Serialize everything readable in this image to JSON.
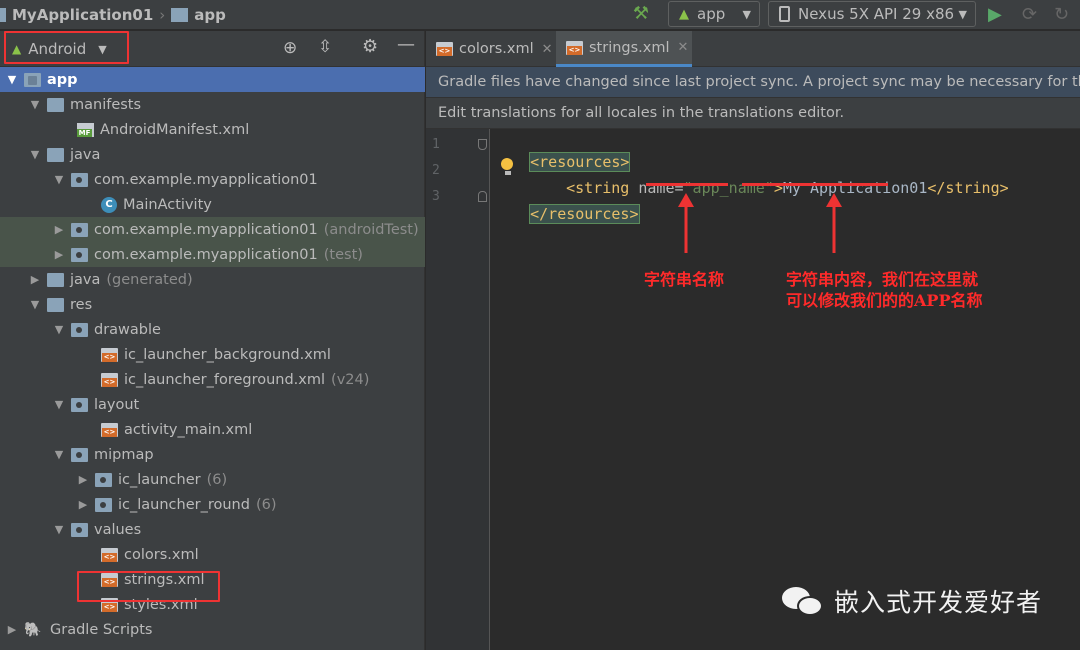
{
  "toolbar": {
    "project": "MyApplication01",
    "module": "app",
    "run_config": "app",
    "device": "Nexus 5X API 29 x86"
  },
  "project_view": {
    "view_mode": "Android",
    "tree": [
      {
        "label": "app",
        "suffix": ""
      },
      {
        "label": "manifests",
        "suffix": ""
      },
      {
        "label": "AndroidManifest.xml",
        "suffix": ""
      },
      {
        "label": "java",
        "suffix": ""
      },
      {
        "label": "com.example.myapplication01",
        "suffix": ""
      },
      {
        "label": "MainActivity",
        "suffix": ""
      },
      {
        "label": "com.example.myapplication01",
        "suffix": "(androidTest)"
      },
      {
        "label": "com.example.myapplication01",
        "suffix": "(test)"
      },
      {
        "label": "java",
        "suffix": "(generated)"
      },
      {
        "label": "res",
        "suffix": ""
      },
      {
        "label": "drawable",
        "suffix": ""
      },
      {
        "label": "ic_launcher_background.xml",
        "suffix": ""
      },
      {
        "label": "ic_launcher_foreground.xml",
        "suffix": "(v24)"
      },
      {
        "label": "layout",
        "suffix": ""
      },
      {
        "label": "activity_main.xml",
        "suffix": ""
      },
      {
        "label": "mipmap",
        "suffix": ""
      },
      {
        "label": "ic_launcher",
        "suffix": "(6)"
      },
      {
        "label": "ic_launcher_round",
        "suffix": "(6)"
      },
      {
        "label": "values",
        "suffix": ""
      },
      {
        "label": "colors.xml",
        "suffix": ""
      },
      {
        "label": "strings.xml",
        "suffix": ""
      },
      {
        "label": "styles.xml",
        "suffix": ""
      },
      {
        "label": "Gradle Scripts",
        "suffix": ""
      }
    ]
  },
  "editor": {
    "tabs": [
      {
        "label": "colors.xml"
      },
      {
        "label": "strings.xml"
      }
    ],
    "sync_banner": "Gradle files have changed since last project sync. A project sync may be necessary for the IDE",
    "translations_banner": "Edit translations for all locales in the translations editor.",
    "line_numbers": [
      "1",
      "2",
      "3"
    ],
    "code": {
      "open_tag": "<resources>",
      "string_open": "<string ",
      "attr_name": "name=",
      "attr_value": "\"app_name\"",
      "gt": ">",
      "text": "My Application01",
      "string_close": "</string>",
      "close_tag": "</resources>"
    }
  },
  "annotations": {
    "name_label": "字符串名称",
    "content_line1": "字符串内容，我们在这里就",
    "content_line2": "可以修改我们的的APP名称"
  },
  "watermark": "嵌入式开发爱好者"
}
